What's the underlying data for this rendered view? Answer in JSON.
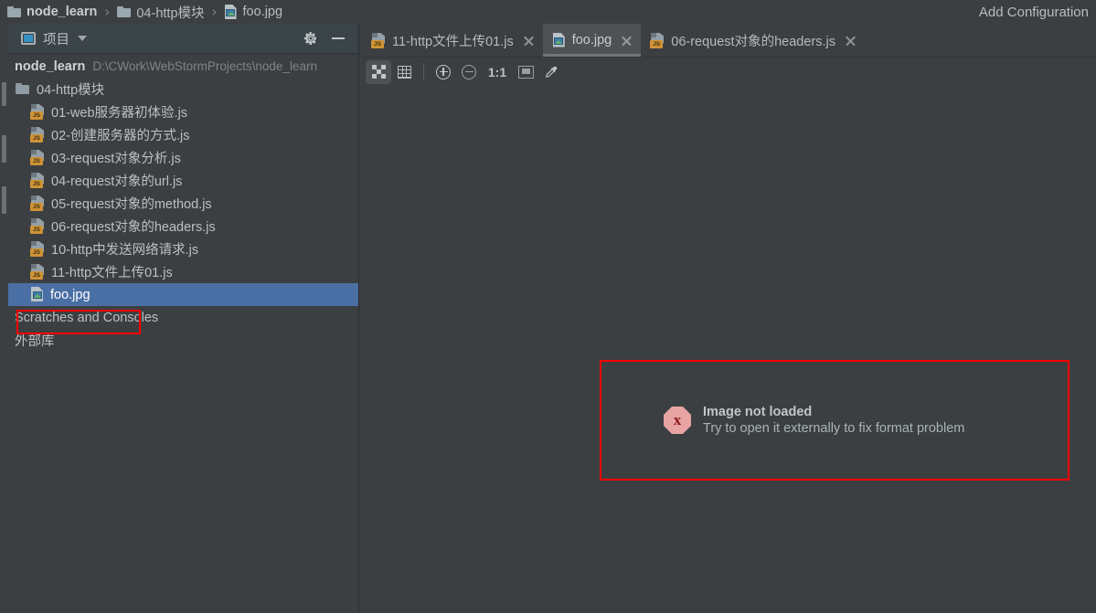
{
  "breadcrumb": {
    "items": [
      {
        "label": "node_learn",
        "icon": "folder-icon",
        "bold": true
      },
      {
        "label": "04-http模块",
        "icon": "folder-icon",
        "bold": false
      },
      {
        "label": "foo.jpg",
        "icon": "image-file-icon",
        "bold": false
      }
    ],
    "separator": "›"
  },
  "toolbar_right": {
    "add_configuration": "Add Configuration"
  },
  "project_panel": {
    "title": "项目",
    "gear_tooltip": "gear-icon",
    "minimize_tooltip": "minimize-icon",
    "tree": [
      {
        "label": "node_learn",
        "path": "D:\\CWork\\WebStormProjects\\node_learn",
        "icon": "project-root-icon",
        "indent": 0,
        "type": "root"
      },
      {
        "label": "04-http模块",
        "path": "",
        "icon": "folder-icon",
        "indent": 1,
        "type": "folder"
      },
      {
        "label": "01-web服务器初体验.js",
        "path": "",
        "icon": "js-file-icon",
        "indent": 2,
        "type": "js"
      },
      {
        "label": "02-创建服务器的方式.js",
        "path": "",
        "icon": "js-file-icon",
        "indent": 2,
        "type": "js"
      },
      {
        "label": "03-request对象分析.js",
        "path": "",
        "icon": "js-file-icon",
        "indent": 2,
        "type": "js"
      },
      {
        "label": "04-request对象的url.js",
        "path": "",
        "icon": "js-file-icon",
        "indent": 2,
        "type": "js"
      },
      {
        "label": "05-request对象的method.js",
        "path": "",
        "icon": "js-file-icon",
        "indent": 2,
        "type": "js"
      },
      {
        "label": "06-request对象的headers.js",
        "path": "",
        "icon": "js-file-icon",
        "indent": 2,
        "type": "js"
      },
      {
        "label": "10-http中发送网络请求.js",
        "path": "",
        "icon": "js-file-icon",
        "indent": 2,
        "type": "js"
      },
      {
        "label": "11-http文件上传01.js",
        "path": "",
        "icon": "js-file-icon",
        "indent": 2,
        "type": "js"
      },
      {
        "label": "foo.jpg",
        "path": "",
        "icon": "image-file-icon",
        "indent": 2,
        "type": "jpg",
        "selected": true
      },
      {
        "label": "Scratches and Consoles",
        "path": "",
        "icon": "none",
        "indent": 0,
        "type": "plain"
      },
      {
        "label": "外部库",
        "path": "",
        "icon": "none",
        "indent": 0,
        "type": "plain"
      }
    ],
    "selection_highlight_color": "#ff0000"
  },
  "editor": {
    "tabs": [
      {
        "label": "11-http文件上传01.js",
        "icon": "js-file-icon",
        "active": false,
        "close": "×"
      },
      {
        "label": "foo.jpg",
        "icon": "image-file-icon",
        "active": true,
        "close": "×"
      },
      {
        "label": "06-request对象的headers.js",
        "icon": "js-file-icon",
        "active": false,
        "close": "×"
      }
    ],
    "image_toolbar": [
      {
        "name": "toggle-transparency-chessboard-icon",
        "label": "",
        "active": true
      },
      {
        "name": "toggle-grid-icon",
        "label": "",
        "active": false
      },
      {
        "name": "zoom-in-icon",
        "label": "",
        "active": false
      },
      {
        "name": "zoom-out-icon",
        "label": "",
        "active": false
      },
      {
        "name": "actual-size-label",
        "label": "1:1",
        "active": false
      },
      {
        "name": "fit-to-window-icon",
        "label": "",
        "active": false
      },
      {
        "name": "color-picker-icon",
        "label": "",
        "active": false
      }
    ],
    "error": {
      "title": "Image not loaded",
      "subtitle": "Try to open it externally to fix format problem",
      "icon": "error-stop-icon",
      "icon_glyph": "x",
      "outline_color": "#ff0000"
    }
  },
  "colors": {
    "window_bg": "#3c3f41",
    "panel_header_bg": "#3b4449",
    "active_tab_bg": "#4e5254",
    "selection_bg": "#4a6fa5",
    "accent_red": "#ff0000",
    "js_badge": "#cf9336"
  }
}
